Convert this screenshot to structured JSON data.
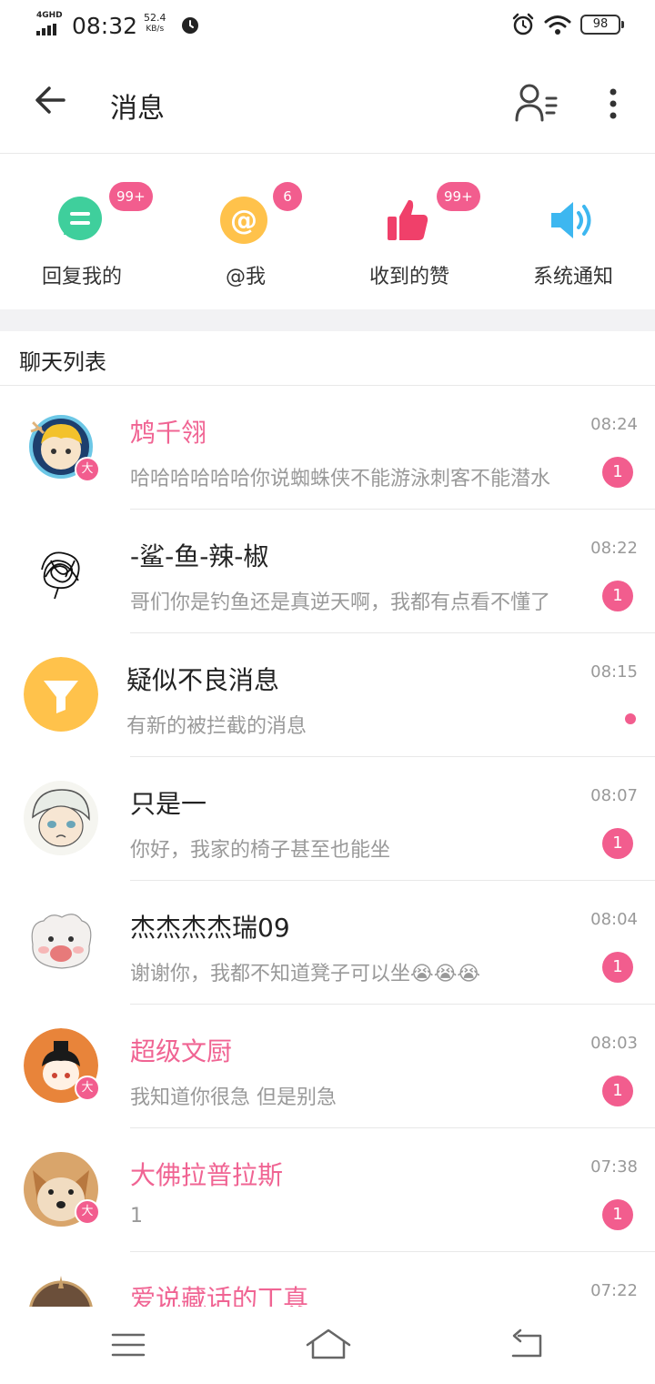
{
  "status_bar": {
    "network": "4GHD",
    "time": "08:32",
    "speed_value": "52.4",
    "speed_unit": "KB/s",
    "battery": "98"
  },
  "header": {
    "title": "消息"
  },
  "quick_actions": [
    {
      "label": "回复我的",
      "badge": "99+",
      "icon": "comment-icon",
      "color": "#3fcf9c"
    },
    {
      "label": "@我",
      "badge": "6",
      "icon": "at-icon",
      "color": "#ffc24b"
    },
    {
      "label": "收到的赞",
      "badge": "99+",
      "icon": "thumbs-up-icon",
      "color": "#f0406a"
    },
    {
      "label": "系统通知",
      "badge": "",
      "icon": "speaker-icon",
      "color": "#3db7f0"
    }
  ],
  "chat_list": {
    "title": "聊天列表",
    "items": [
      {
        "name": "鸩千翎",
        "message": "哈哈哈哈哈哈你说蜘蛛侠不能游泳刺客不能潜水",
        "time": "08:24",
        "unread": "1",
        "vip_label": "大"
      },
      {
        "name": "-鲨-鱼-辣-椒",
        "message": "哥们你是钓鱼还是真逆天啊，我都有点看不懂了",
        "time": "08:22",
        "unread": "1"
      },
      {
        "name": "疑似不良消息",
        "message": "有新的被拦截的消息",
        "time": "08:15"
      },
      {
        "name": "只是一",
        "message": "你好，我家的椅子甚至也能坐",
        "time": "08:07",
        "unread": "1"
      },
      {
        "name": "杰杰杰杰瑞09",
        "message": "谢谢你，我都不知道凳子可以坐😭😭😭",
        "time": "08:04",
        "unread": "1"
      },
      {
        "name": "超级文厨",
        "message": "我知道你很急 但是别急",
        "time": "08:03",
        "unread": "1",
        "vip_label": "大"
      },
      {
        "name": "大佛拉普拉斯",
        "message": "1",
        "time": "07:38",
        "unread": "1",
        "vip_label": "大"
      },
      {
        "name": "爱说藏话的丁真",
        "message": "",
        "time": "07:22"
      }
    ]
  },
  "colors": {
    "accent_pink": "#f25d8e",
    "vip_name_pink": "#f06493",
    "filter_orange": "#ffc24b"
  }
}
